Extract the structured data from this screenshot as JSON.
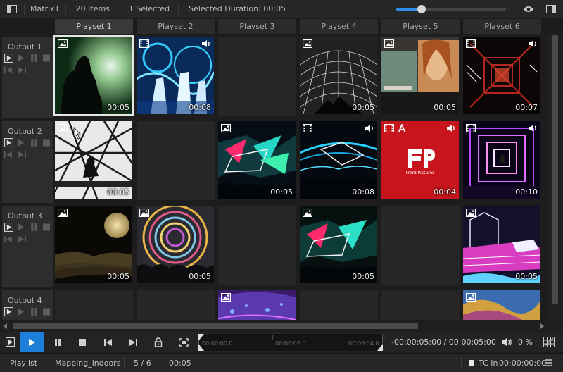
{
  "topbar": {
    "matrix_name": "Matrix1",
    "item_count": "20 Items",
    "selected_count": "1 Selected",
    "selected_duration": "Selected Duration: 00:05",
    "zoom_level": 0.23
  },
  "columns": [
    "Playset 1",
    "Playset 2",
    "Playset 3",
    "Playset 4",
    "Playset 5",
    "Playset 6"
  ],
  "rows": [
    {
      "label": "Output 1"
    },
    {
      "label": "Output 2"
    },
    {
      "label": "Output 3"
    },
    {
      "label": "Output 4"
    }
  ],
  "cells": {
    "r1c1": {
      "duration": "00:05",
      "type": "image"
    },
    "r1c2": {
      "duration": "00:08",
      "type": "video"
    },
    "r1c4": {
      "duration": "00:05",
      "type": "image"
    },
    "r1c5": {
      "duration": "00:05",
      "type": "image"
    },
    "r1c6": {
      "duration": "00:07",
      "type": "video"
    },
    "r2c1": {
      "duration": "00:05",
      "type": "image"
    },
    "r2c3": {
      "duration": "00:05",
      "type": "image"
    },
    "r2c4": {
      "duration": "00:08",
      "type": "video"
    },
    "r2c5": {
      "duration": "00:04",
      "type": "video",
      "logo_text": "Front Pictures"
    },
    "r2c6": {
      "duration": "00:10",
      "type": "video"
    },
    "r3c1": {
      "duration": "00:05",
      "type": "image"
    },
    "r3c2": {
      "duration": "00:05",
      "type": "image"
    },
    "r3c4": {
      "duration": "00:05",
      "type": "image"
    },
    "r3c6": {
      "duration": "00:05",
      "type": "image"
    },
    "r4c3": {
      "type": "image"
    },
    "r4c6": {
      "type": "image"
    }
  },
  "transport": {
    "timeline_labels": [
      "00:00:00.0",
      "00:00:02.0",
      "00:00:04.0"
    ],
    "timecode": "-00:00:05:00 / 00:00:05:00",
    "volume": "0 %"
  },
  "statusbar": {
    "mode": "Playlist",
    "project": "Mapping_indoors",
    "position": "5 / 6",
    "duration": "00:05",
    "tc_label": "TC In",
    "tc_value": "00:00:00:00"
  },
  "colors": {
    "accent": "#1e7fd8",
    "selection": "#e6e6e6",
    "red_tile": "#c8151d"
  },
  "icons": [
    "panel-toggle-icon",
    "eye-icon",
    "panel-right-icon",
    "image-icon",
    "video-icon",
    "audio-icon",
    "text-icon",
    "play-icon",
    "pause-icon",
    "stop-icon",
    "prev-icon",
    "next-icon",
    "lock-icon",
    "fit-icon",
    "volume-icon",
    "grid-icon",
    "menu-icon"
  ]
}
